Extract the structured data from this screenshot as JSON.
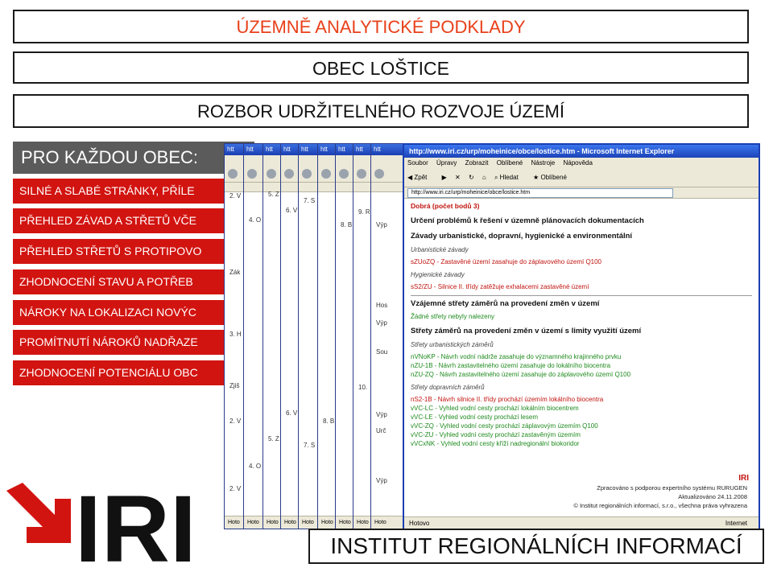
{
  "header": {
    "title": "ÚZEMNĚ ANALYTICKÉ PODKLADY",
    "municipality": "OBEC LOŠTICE",
    "subtitle": "ROZBOR UDRŽITELNÉHO ROZVOJE ÚZEMÍ"
  },
  "left_panel": {
    "heading": "PRO KAŽDOU OBEC:",
    "rows": [
      "SILNÉ A SLABÉ STRÁNKY, PŘÍLE",
      "PŘEHLED ZÁVAD A STŘETŮ VČE",
      "PŘEHLED STŘETŮ S PROTIPOVO",
      "ZHODNOCENÍ STAVU A POTŘEB",
      "NÁROKY NA LOKALIZACI NOVÝC",
      "PROMÍTNUTÍ NÁROKŮ NADŘAZE",
      "ZHODNOCENÍ POTENCIÁLU OBC"
    ]
  },
  "browser": {
    "title": "http://www.iri.cz/urp/moheinice/obce/lostice.htm - Microsoft Internet Explorer",
    "menu": [
      "Soubor",
      "Úpravy",
      "Zobrazit",
      "Oblíbené",
      "Nástroje",
      "Nápověda"
    ],
    "toolbar": [
      "Zpět",
      "Hledat",
      "Oblíbené"
    ],
    "address": "http://www.iri.cz/urp/moheinice/obce/lostice.htm",
    "status_left": "Hotovo",
    "status_right": "Internet",
    "content": {
      "rating": "Dobrá (počet bodů 3)",
      "section1": "Určení problémů k řešení v územně plánovacích dokumentacích",
      "section2": "Závady urbanistické, dopravní, hygienické a environmentální",
      "sub_urban": "Urbanistické závady",
      "item_urban": "sZUoZQ - Zastavěné území zasahuje do záplavového území Q100",
      "sub_hyg": "Hygienické závady",
      "item_hyg": "sS2/ZU - Silnice II. třídy zatěžuje exhalacemi zastavěné území",
      "section3": "Vzájemné střety záměrů na provedení změn v území",
      "no_conflict": "Žádné střety nebyly nalezeny",
      "section4": "Střety záměrů na provedení změn v území s limity využití území",
      "sub_urb_plans": "Střety urbanistických záměrů",
      "urb_plans": [
        "nVNoKP - Návrh vodní nádrže zasahuje do významného krajinného prvku",
        "nZU-1B - Návrh zastavitelného území zasahuje do lokálního biocentra",
        "nZU-ZQ - Návrh zastavitelného území zasahuje do záplavového území Q100"
      ],
      "sub_traffic": "Střety dopravních záměrů",
      "traffic_red": "nS2-1B - Návrh silnice II. třídy prochází územím lokálního biocentra",
      "traffic": [
        "vVC-LC - Vyhled vodní cesty prochází lokálním biocentrem",
        "vVC-LE - Vyhled vodní cesty prochází lesem",
        "vVC-ZQ - Vyhled vodní cesty prochází záplavovým územím Q100",
        "vVC-ZU - Vyhled vodní cesty prochází zastavěným územím",
        "vVCxNK - Vyhled vodní cesty kříží nadregionální biokoridor"
      ],
      "footer_line1": "Zpracováno s podporou expertního systému RURUGEN",
      "footer_line2": "Aktualizováno 24.11.2008",
      "footer_line3": "© Institut regionálních informací, s.r.o., všechna práva vyhrazena",
      "mini_logo": "IRI"
    }
  },
  "back_windows": {
    "labels": [
      "2. V",
      "5. Z",
      "6. V",
      "7. S",
      "8. B",
      "9. R",
      "10.",
      "3. H",
      "4. O",
      "Zák",
      "Zjiš",
      "Výp",
      "Hos",
      "Sou",
      "Urč"
    ],
    "status": "Hoto",
    "title": "htt"
  },
  "logo": {
    "text": "IRI",
    "colors": {
      "arrow": "#d21410",
      "text": "#111111"
    }
  },
  "footer": {
    "institute": "INSTITUT REGIONÁLNÍCH INFORMACÍ"
  },
  "colors": {
    "accent_red": "#d21410",
    "title_orange": "#e8401a",
    "dark_gray": "#5b5b5b"
  }
}
